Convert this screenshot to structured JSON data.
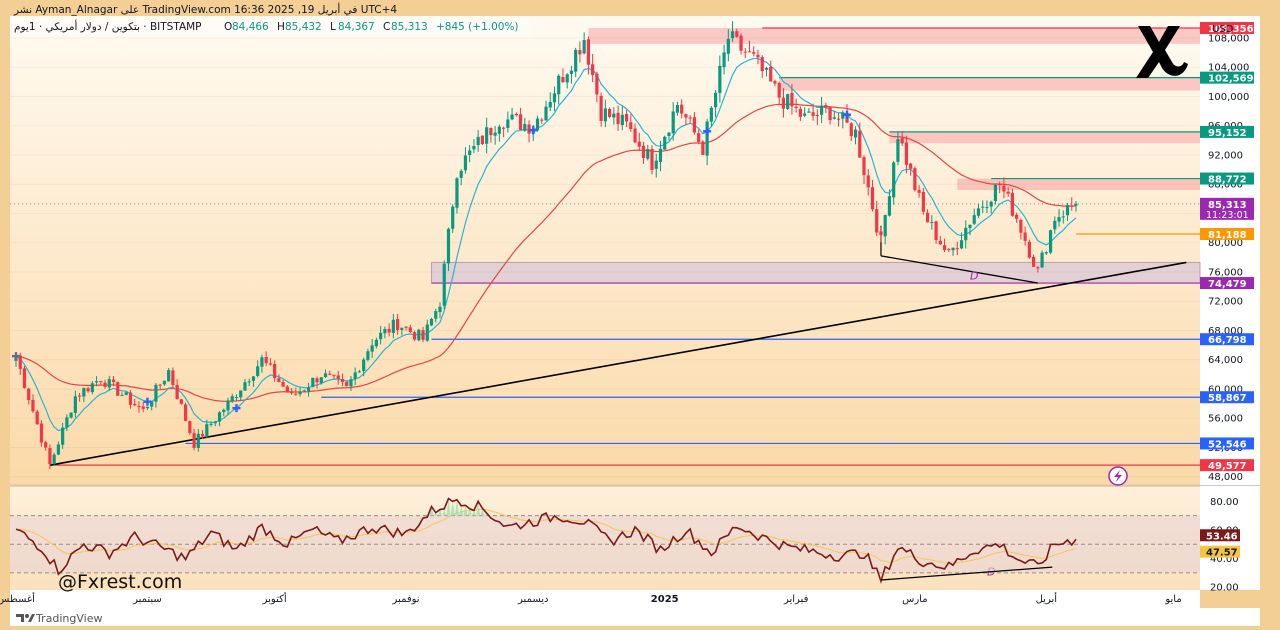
{
  "header": {
    "author_line": "نشر Ayman_Alnagar على TradingView.com في أبريل 19, 2025 16:36 UTC+4",
    "symbol": "بتكوين / دولار أمريكي · 1يوم · BITSTAMP",
    "ohlc": [
      {
        "label": "O",
        "value": "84,466"
      },
      {
        "label": "H",
        "value": "85,432"
      },
      {
        "label": "L",
        "value": "84,367"
      },
      {
        "label": "C",
        "value": "85,313"
      }
    ],
    "change": "+845 (+1.00%)"
  },
  "watermark": "@Fxrest.com",
  "footer_brand": "TradingView",
  "colors": {
    "up": "#089981",
    "down": "#f23645",
    "ema_fast": "#26b5d6",
    "ema_slow": "#e04848",
    "rsi": "#7b1a1a",
    "support_blue": "#2962ff",
    "resistance_zone": "#f7a3a3",
    "demand_zone": "#d9c8d8",
    "current_price": "#9c27b0",
    "orange_level": "#ff9800",
    "background": "#fde8c9"
  },
  "chart_data": [
    {
      "type": "candlestick",
      "title": "",
      "currency": "USD",
      "ylim": [
        47000,
        111000
      ],
      "y_ticks": [
        "48,000",
        "52,000",
        "56,000",
        "60,000",
        "64,000",
        "68,000",
        "72,000",
        "76,000",
        "80,000",
        "84,000",
        "88,000",
        "92,000",
        "96,000",
        "100,000",
        "104,000",
        "108,000"
      ],
      "x_ticks": [
        {
          "label": "أغسطس",
          "t": 0
        },
        {
          "label": "سبتمبر",
          "t": 31
        },
        {
          "label": "أكتوبر",
          "t": 61
        },
        {
          "label": "نوفمبر",
          "t": 92
        },
        {
          "label": "ديسمبر",
          "t": 122
        },
        {
          "label": "2025",
          "t": 153
        },
        {
          "label": "فبراير",
          "t": 184
        },
        {
          "label": "مارس",
          "t": 212
        },
        {
          "label": "أبريل",
          "t": 243
        },
        {
          "label": "مايو",
          "t": 273
        }
      ],
      "last_close": 85313,
      "price_labels": [
        {
          "text": "109,356",
          "value": 109356,
          "kind": "resistance"
        },
        {
          "text": "102,569",
          "value": 102569,
          "kind": "support-green"
        },
        {
          "text": "95,152",
          "value": 95152,
          "kind": "support-green"
        },
        {
          "text": "88,772",
          "value": 88772,
          "kind": "support-green"
        },
        {
          "text": "85,313",
          "value": 85313,
          "kind": "current",
          "countdown": "11:23:01"
        },
        {
          "text": "81,188",
          "value": 81188,
          "kind": "orange"
        },
        {
          "text": "74,479",
          "value": 74479,
          "kind": "current"
        },
        {
          "text": "66,798",
          "value": 66798,
          "kind": "support-blue"
        },
        {
          "text": "58,867",
          "value": 58867,
          "kind": "support-blue"
        },
        {
          "text": "52,546",
          "value": 52546,
          "kind": "support-blue"
        },
        {
          "text": "49,577",
          "value": 49577,
          "kind": "resistance"
        }
      ],
      "annotations": [
        {
          "text": "D",
          "t": 225,
          "value": 75500
        },
        {
          "text": "D",
          "t": 229,
          "value": 31,
          "panel": "rsi"
        }
      ],
      "trendline": {
        "from": {
          "t": 8,
          "value": 49577
        },
        "to": {
          "t": 276,
          "value": 77300
        }
      },
      "divergence_line": [
        {
          "t": 204,
          "value": 78200
        },
        {
          "t": 241,
          "value": 74479
        }
      ],
      "zones": [
        {
          "t0": 135,
          "t1": 278,
          "v0": 107200,
          "v1": 109356,
          "kind": "resistance"
        },
        {
          "t0": 180,
          "t1": 278,
          "v0": 100800,
          "v1": 102569,
          "kind": "resistance"
        },
        {
          "t0": 206,
          "t1": 278,
          "v0": 93600,
          "v1": 95152,
          "kind": "resistance"
        },
        {
          "t0": 222,
          "t1": 278,
          "v0": 87200,
          "v1": 88772,
          "kind": "resistance"
        },
        {
          "t0": 98,
          "t1": 278,
          "v0": 74479,
          "v1": 77300,
          "kind": "demand"
        }
      ],
      "anchors": [
        [
          0,
          64500
        ],
        [
          8,
          49577
        ],
        [
          14,
          59000
        ],
        [
          20,
          61500
        ],
        [
          30,
          57000
        ],
        [
          36,
          62500
        ],
        [
          42,
          52546
        ],
        [
          50,
          58000
        ],
        [
          58,
          64000
        ],
        [
          65,
          58867
        ],
        [
          72,
          62000
        ],
        [
          78,
          60000
        ],
        [
          84,
          66500
        ],
        [
          90,
          69000
        ],
        [
          96,
          66798
        ],
        [
          100,
          72000
        ],
        [
          104,
          90000
        ],
        [
          114,
          97000
        ],
        [
          122,
          96000
        ],
        [
          128,
          102000
        ],
        [
          134,
          108000
        ],
        [
          138,
          98000
        ],
        [
          144,
          96000
        ],
        [
          150,
          91000
        ],
        [
          156,
          99000
        ],
        [
          162,
          93000
        ],
        [
          168,
          108000
        ],
        [
          174,
          105000
        ],
        [
          180,
          100000
        ],
        [
          186,
          97000
        ],
        [
          192,
          98000
        ],
        [
          198,
          95000
        ],
        [
          204,
          80000
        ],
        [
          208,
          95000
        ],
        [
          214,
          84000
        ],
        [
          220,
          78200
        ],
        [
          226,
          84000
        ],
        [
          232,
          88000
        ],
        [
          236,
          83500
        ],
        [
          241,
          76000
        ],
        [
          245,
          83500
        ],
        [
          250,
          85313
        ]
      ],
      "ema_fast_period": 9,
      "ema_slow_period": 50,
      "moving_average_markers_t": [
        0,
        31,
        52,
        122,
        163,
        196
      ]
    },
    {
      "type": "line",
      "panel": "rsi",
      "ylim": [
        18,
        90
      ],
      "y_ticks": [
        "20.00",
        "40.00",
        "60.00",
        "80.00"
      ],
      "band": [
        30,
        70
      ],
      "midline": 50,
      "labels": [
        {
          "text": "53.46",
          "value": 53.46,
          "kind": "rsi"
        },
        {
          "text": "47.57",
          "value": 47.57,
          "kind": "rsi-ma"
        }
      ],
      "anchors": [
        [
          0,
          60
        ],
        [
          6,
          48
        ],
        [
          10,
          32
        ],
        [
          16,
          50
        ],
        [
          22,
          44
        ],
        [
          28,
          55
        ],
        [
          34,
          48
        ],
        [
          40,
          40
        ],
        [
          46,
          58
        ],
        [
          52,
          46
        ],
        [
          58,
          62
        ],
        [
          64,
          50
        ],
        [
          70,
          60
        ],
        [
          76,
          52
        ],
        [
          84,
          62
        ],
        [
          92,
          57
        ],
        [
          98,
          73
        ],
        [
          104,
          82
        ],
        [
          110,
          75
        ],
        [
          116,
          62
        ],
        [
          122,
          66
        ],
        [
          128,
          70
        ],
        [
          134,
          66
        ],
        [
          140,
          52
        ],
        [
          146,
          60
        ],
        [
          152,
          46
        ],
        [
          158,
          60
        ],
        [
          164,
          44
        ],
        [
          170,
          63
        ],
        [
          176,
          55
        ],
        [
          182,
          48
        ],
        [
          188,
          45
        ],
        [
          194,
          42
        ],
        [
          200,
          44
        ],
        [
          204,
          25
        ],
        [
          208,
          48
        ],
        [
          214,
          38
        ],
        [
          220,
          34
        ],
        [
          226,
          46
        ],
        [
          232,
          50
        ],
        [
          236,
          40
        ],
        [
          241,
          34
        ],
        [
          245,
          50
        ],
        [
          250,
          53.46
        ]
      ],
      "divergence_line": [
        {
          "t": 204,
          "value": 25
        },
        {
          "t": 243,
          "value": 34
        }
      ]
    }
  ]
}
